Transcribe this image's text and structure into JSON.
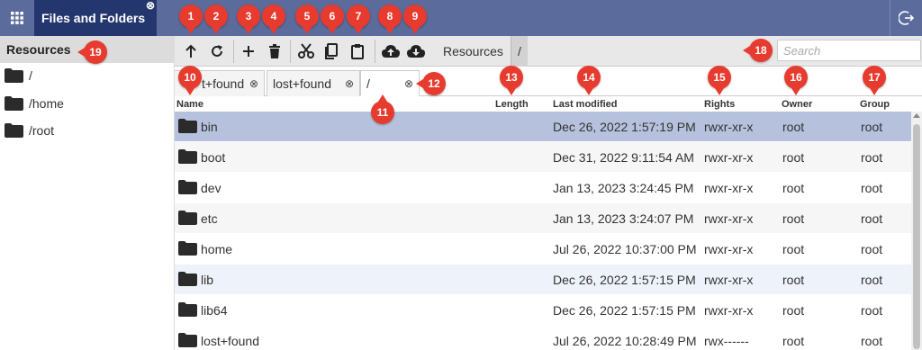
{
  "app": {
    "tab_title": "Files and Folders",
    "tab_close": "⊗"
  },
  "colors": {
    "topbar": "#5b6b9b",
    "active_tab": "#24366e",
    "selected_row": "#b6c1dd",
    "marker": "#e63b2e"
  },
  "left_panel": {
    "header": "Resources",
    "items": [
      {
        "label": "/",
        "icon": "folder-icon"
      },
      {
        "label": "/home",
        "icon": "folder-icon"
      },
      {
        "label": "/root",
        "icon": "folder-icon"
      }
    ]
  },
  "toolbar": {
    "buttons": [
      {
        "name": "up-arrow-icon"
      },
      {
        "name": "refresh-icon"
      },
      {
        "name": "plus-icon"
      },
      {
        "name": "trash-icon"
      },
      {
        "name": "scissors-icon"
      },
      {
        "name": "copy-icon"
      },
      {
        "name": "paste-icon"
      },
      {
        "name": "upload-icon"
      },
      {
        "name": "download-icon"
      }
    ],
    "breadcrumb_resources": "Resources",
    "breadcrumb_root": "/",
    "search_placeholder": "Search"
  },
  "tabs": [
    {
      "label": "t+found",
      "close": "⊗"
    },
    {
      "label": "lost+found",
      "close": "⊗"
    },
    {
      "label": "/",
      "close": "⊗"
    }
  ],
  "columns": {
    "name": "Name",
    "length": "Length",
    "modified": "Last modified",
    "rights": "Rights",
    "owner": "Owner",
    "group": "Group"
  },
  "rows": [
    {
      "name": "bin",
      "modified": "Dec 26, 2022 1:57:19 PM",
      "rights": "rwxr-xr-x",
      "owner": "root",
      "group": "root"
    },
    {
      "name": "boot",
      "modified": "Dec 31, 2022 9:11:54 AM",
      "rights": "rwxr-xr-x",
      "owner": "root",
      "group": "root"
    },
    {
      "name": "dev",
      "modified": "Jan 13, 2023 3:24:45 PM",
      "rights": "rwxr-xr-x",
      "owner": "root",
      "group": "root"
    },
    {
      "name": "etc",
      "modified": "Jan 13, 2023 3:24:07 PM",
      "rights": "rwxr-xr-x",
      "owner": "root",
      "group": "root"
    },
    {
      "name": "home",
      "modified": "Jul 26, 2022 10:37:00 PM",
      "rights": "rwxr-xr-x",
      "owner": "root",
      "group": "root"
    },
    {
      "name": "lib",
      "modified": "Dec 26, 2022 1:57:15 PM",
      "rights": "rwxr-xr-x",
      "owner": "root",
      "group": "root"
    },
    {
      "name": "lib64",
      "modified": "Dec 26, 2022 1:57:15 PM",
      "rights": "rwxr-xr-x",
      "owner": "root",
      "group": "root"
    },
    {
      "name": "lost+found",
      "modified": "Jul 26, 2022 10:28:49 PM",
      "rights": "rwx------",
      "owner": "root",
      "group": "root"
    }
  ],
  "markers": [
    "1",
    "2",
    "3",
    "4",
    "5",
    "6",
    "7",
    "8",
    "9",
    "10",
    "11",
    "12",
    "13",
    "14",
    "15",
    "16",
    "17",
    "18",
    "19"
  ]
}
